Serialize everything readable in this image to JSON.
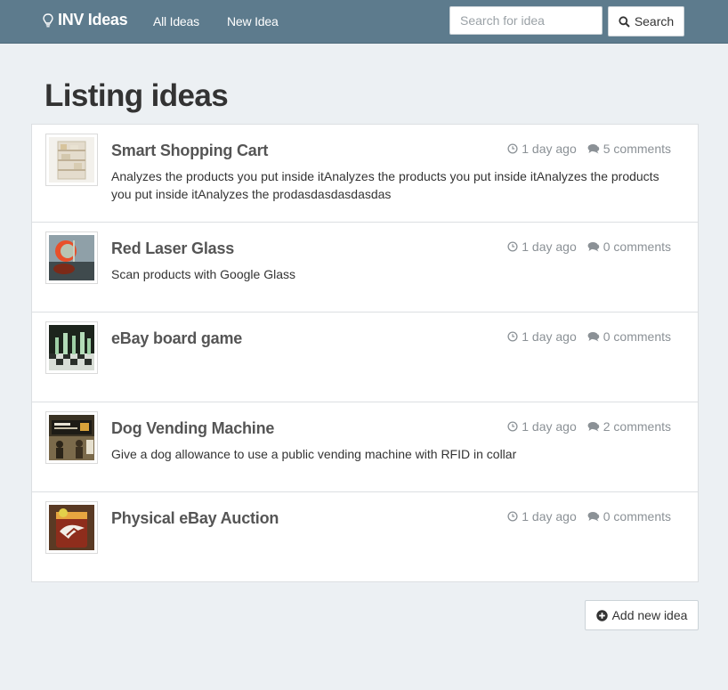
{
  "nav": {
    "brand": "INV Ideas",
    "brand_icon": "lightbulb-icon",
    "links": [
      {
        "label": "All Ideas"
      },
      {
        "label": "New Idea"
      }
    ],
    "search": {
      "placeholder": "Search for idea",
      "value": "",
      "button_label": "Search",
      "icon": "search-icon"
    }
  },
  "page": {
    "title": "Listing ideas"
  },
  "ideas": [
    {
      "title": "Smart Shopping Cart",
      "time": "1 day ago",
      "comments": "5 comments",
      "description": "Analyzes the products you put inside itAnalyzes the products you put inside itAnalyzes the products you put inside itAnalyzes the prodasdasdasdasdas"
    },
    {
      "title": "Red Laser Glass",
      "time": "1 day ago",
      "comments": "0 comments",
      "description": "Scan products with Google Glass"
    },
    {
      "title": "eBay board game",
      "time": "1 day ago",
      "comments": "0 comments",
      "description": ""
    },
    {
      "title": "Dog Vending Machine",
      "time": "1 day ago",
      "comments": "2 comments",
      "description": "Give a dog allowance to use a public vending machine with RFID in collar"
    },
    {
      "title": "Physical eBay Auction",
      "time": "1 day ago",
      "comments": "0 comments",
      "description": ""
    }
  ],
  "footer": {
    "add_label": "Add new idea",
    "add_icon": "plus-circle-icon"
  },
  "colors": {
    "navbar": "#5d7b8d",
    "background": "#ecf0f3",
    "meta_text": "#8b9196"
  }
}
